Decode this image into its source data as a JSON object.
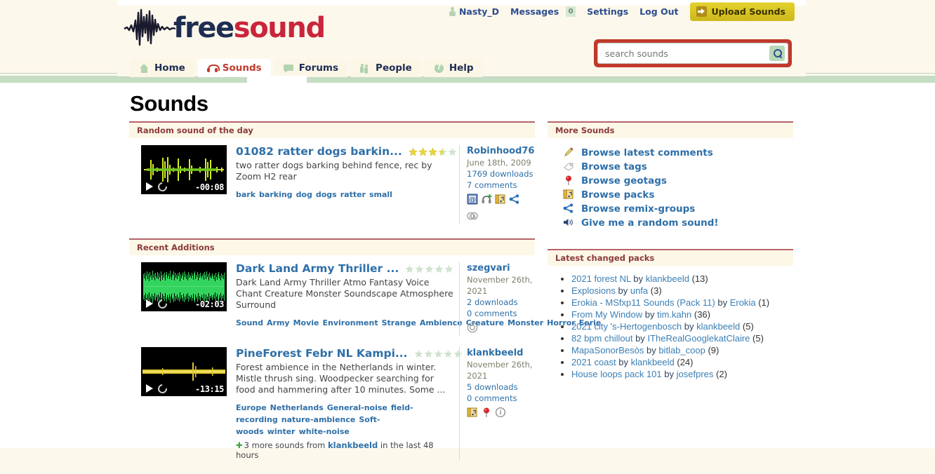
{
  "site": {
    "logo_free": "free",
    "logo_sound": "sound"
  },
  "userbar": {
    "username": "Nasty_D",
    "messages_label": "Messages",
    "messages_count": "0",
    "settings_label": "Settings",
    "logout_label": "Log Out",
    "upload_label": "Upload Sounds"
  },
  "search": {
    "placeholder": "search sounds",
    "value": ""
  },
  "nav": {
    "tabs": [
      {
        "label": "Home",
        "icon": "home-icon",
        "active": false
      },
      {
        "label": "Sounds",
        "icon": "headphones-icon",
        "active": true
      },
      {
        "label": "Forums",
        "icon": "speech-bubble-icon",
        "active": false
      },
      {
        "label": "People",
        "icon": "people-icon",
        "active": false
      },
      {
        "label": "Help",
        "icon": "question-icon",
        "active": false
      }
    ]
  },
  "page": {
    "title": "Sounds"
  },
  "random_sound_panel": {
    "heading": "Random sound of the day",
    "sound": {
      "title": "01082 ratter dogs barkin...",
      "duration": "-00:08",
      "rating": 3.5,
      "description": "two ratter dogs barking behind fence, rec by Zoom H2 rear",
      "tags": [
        "bark",
        "barking",
        "dog",
        "dogs",
        "ratter",
        "small"
      ],
      "user": "Robinhood76",
      "date": "June 18th, 2009",
      "downloads": "1769 downloads",
      "comments": "7 comments",
      "icons": [
        "email-attribution-icon",
        "headphones-plus-icon",
        "pack-icon",
        "remix-icon",
        "creative-commons-icon"
      ]
    }
  },
  "recent_panel": {
    "heading": "Recent Additions",
    "sounds": [
      {
        "title": "Dark Land Army Thriller ...",
        "duration": "-02:03",
        "rating": 0,
        "description": "Dark Land Army Thriller Atmo Fantasy Voice Chant Creature Monster Soundscape Atmosphere Surround",
        "tags": [
          "Sound",
          "Army",
          "Movie",
          "Environment",
          "Strange",
          "Ambience",
          "Creature",
          "Monster",
          "Horror",
          "Eerie"
        ],
        "user": "szegvari",
        "date": "November 26th, 2021",
        "downloads": "2 downloads",
        "comments": "0 comments",
        "icons": [
          "cc-zero-icon"
        ],
        "more_line": null
      },
      {
        "title": "PineForest Febr NL Kampi...",
        "duration": "-13:15",
        "rating": 0,
        "description": "Forest ambience in the Netherlands in winter. Mistle thrush sing. Woodpecker searching for food and hammering after 10 minutes. Some ...",
        "tags": [
          "Europe",
          "Netherlands",
          "General-noise",
          "field-recording",
          "nature-ambience",
          "Soft-woods",
          "winter",
          "white-noise"
        ],
        "user": "klankbeeld",
        "date": "November 26th, 2021",
        "downloads": "5 downloads",
        "comments": "0 comments",
        "icons": [
          "pack-icon",
          "geotag-pin-icon",
          "info-icon"
        ],
        "more_line": {
          "prefix": "3 more sounds from",
          "user": "klankbeeld",
          "suffix": "in the last 48 hours"
        }
      }
    ]
  },
  "more_sounds_panel": {
    "heading": "More Sounds",
    "items": [
      {
        "label": "Browse latest comments",
        "icon": "pencil-icon"
      },
      {
        "label": "Browse tags",
        "icon": "tag-icon"
      },
      {
        "label": "Browse geotags",
        "icon": "geotag-pin-icon"
      },
      {
        "label": "Browse packs",
        "icon": "pack-icon"
      },
      {
        "label": "Browse remix-groups",
        "icon": "remix-icon"
      },
      {
        "label": "Give me a random sound!",
        "icon": "speaker-icon"
      }
    ]
  },
  "packs_panel": {
    "heading": "Latest changed packs",
    "by_word": "by",
    "items": [
      {
        "name": "2021 forest NL",
        "user": "klankbeeld",
        "count": "(13)"
      },
      {
        "name": "Explosions",
        "user": "unfa",
        "count": "(3)"
      },
      {
        "name": "Erokia - MSfxp11 Sounds (Pack 11)",
        "user": "Erokia",
        "count": "(1)"
      },
      {
        "name": "From My Window",
        "user": "tim.kahn",
        "count": "(36)"
      },
      {
        "name": "2021 city 's-Hertogenbosch",
        "user": "klankbeeld",
        "count": "(5)"
      },
      {
        "name": "82 bpm chillout",
        "user": "ITheRealGooglekatClaire",
        "count": "(5)"
      },
      {
        "name": "MapaSonorBesòs",
        "user": "bitlab_coop",
        "count": "(9)"
      },
      {
        "name": "2021 coast",
        "user": "klankbeeld",
        "count": "(24)"
      },
      {
        "name": "House loops pack 101",
        "user": "josefpres",
        "count": "(2)"
      }
    ]
  },
  "colors": {
    "brand_red": "#c0392b",
    "link_blue": "#2e6fa8",
    "nav_navy": "#1e2d52",
    "cream": "#fdf8ec",
    "green_bar": "#c4ddc3",
    "upload_yellow": "#d8c722",
    "star_gold": "#e8d53a"
  }
}
